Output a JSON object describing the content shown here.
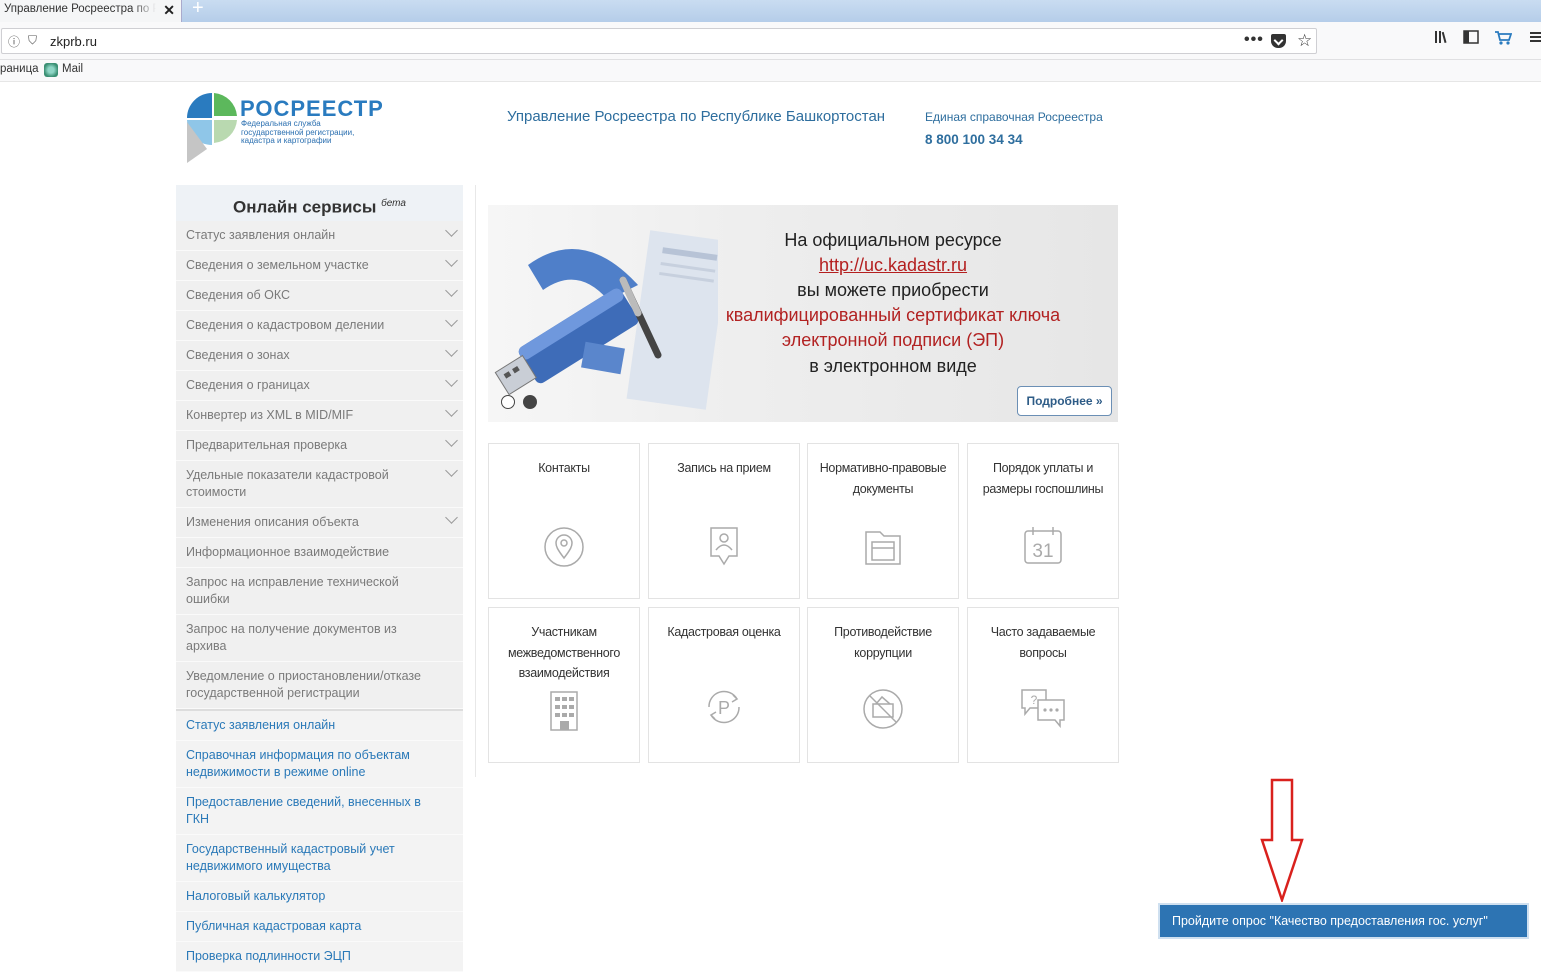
{
  "browser": {
    "tab_title": "Управление Росреестра по Ре",
    "url": "zkprb.ru",
    "bookmarks": [
      "раница",
      "Mail"
    ]
  },
  "header": {
    "logo_title": "РОСРЕЕСТР",
    "logo_subtitle": "Федеральная служба государственной регистрации, кадастра и картографии",
    "title": "Управление Росреестра по Республике Башкортостан",
    "help_label": "Единая справочная Росреестра",
    "phone": "8 800 100 34 34"
  },
  "sidebar": {
    "heading": "Онлайн сервисы",
    "heading_badge": "бета",
    "items": [
      {
        "label": "Статус заявления онлайн",
        "expandable": true
      },
      {
        "label": "Сведения о земельном участке",
        "expandable": true
      },
      {
        "label": "Сведения об ОКС",
        "expandable": true
      },
      {
        "label": "Сведения о кадастровом делении",
        "expandable": true
      },
      {
        "label": "Сведения о зонах",
        "expandable": true
      },
      {
        "label": "Сведения о границах",
        "expandable": true
      },
      {
        "label": "Конвертер из XML в MID/MIF",
        "expandable": true
      },
      {
        "label": "Предварительная проверка",
        "expandable": true
      },
      {
        "label": "Удельные показатели кадастровой стоимости",
        "expandable": true
      },
      {
        "label": "Изменения описания объекта",
        "expandable": true
      },
      {
        "label": "Информационное взаимодействие",
        "expandable": false
      },
      {
        "label": "Запрос на исправление технической ошибки",
        "expandable": false
      },
      {
        "label": "Запрос на получение документов из архива",
        "expandable": false
      },
      {
        "label": "Уведомление о приостановлении/отказе государственной регистрации",
        "expandable": false
      }
    ],
    "links": [
      "Статус заявления онлайн",
      "Справочная информация по объектам недвижимости в режиме online",
      "Предоставление сведений, внесенных в ГКН",
      "Государственный кадастровый учет недвижимого имущества",
      "Налоговый калькулятор",
      "Публичная кадастровая карта",
      "Проверка подлинности ЭЦП"
    ]
  },
  "banner": {
    "line1": "На официальном ресурсе",
    "link": "http://uc.kadastr.ru",
    "line2": "вы можете приобрести",
    "red1": "квалифицированный сертификат ключа",
    "red2": "электронной подписи (ЭП)",
    "line3": "в электронном виде",
    "more_button": "Подробнее »",
    "slides_total": 2,
    "slide_active": 2
  },
  "tiles": [
    {
      "label": "Контакты",
      "icon": "location-pin-icon"
    },
    {
      "label": "Запись на прием",
      "icon": "appointment-icon"
    },
    {
      "label": "Нормативно-правовые документы",
      "icon": "documents-icon"
    },
    {
      "label": "Порядок уплаты и размеры госпошлины",
      "icon": "calendar-icon"
    },
    {
      "label": "Участникам межведомственного взаимодействия",
      "icon": "building-icon"
    },
    {
      "label": "Кадастровая оценка",
      "icon": "valuation-icon"
    },
    {
      "label": "Противодействие коррупции",
      "icon": "anti-corruption-icon"
    },
    {
      "label": "Часто задаваемые вопросы",
      "icon": "faq-icon"
    }
  ],
  "poll_button": "Пройдите опрос \"Качество предоставления гос. услуг\"",
  "colors": {
    "brand_blue": "#2a7bbf",
    "link_blue": "#2a79b8",
    "banner_red": "#b22222",
    "poll_blue": "#2d74b3",
    "arrow_red": "#d9211d"
  }
}
